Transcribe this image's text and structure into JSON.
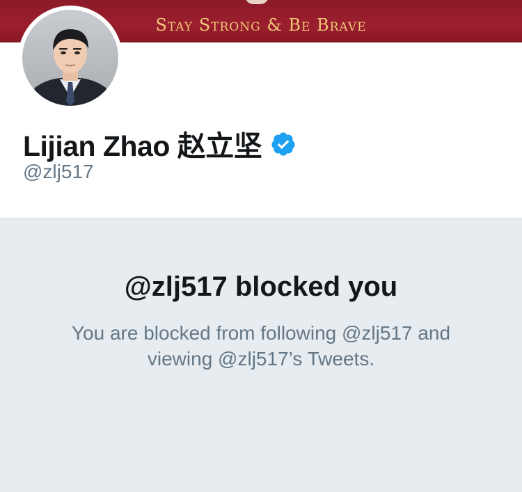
{
  "banner": {
    "text": "Stay Strong & Be Brave",
    "background_color": "#9b1f2e",
    "text_color": "#f2c77a"
  },
  "profile": {
    "display_name": "Lijian Zhao 赵立坚",
    "handle": "@zlj517",
    "verified": true,
    "verified_icon": "verified-badge-icon",
    "verified_color": "#1da1f2"
  },
  "blocked": {
    "title": "@zlj517 blocked you",
    "description": "You are blocked from following @zlj517 and viewing @zlj517’s Tweets.",
    "panel_color": "#e6ecf0"
  }
}
